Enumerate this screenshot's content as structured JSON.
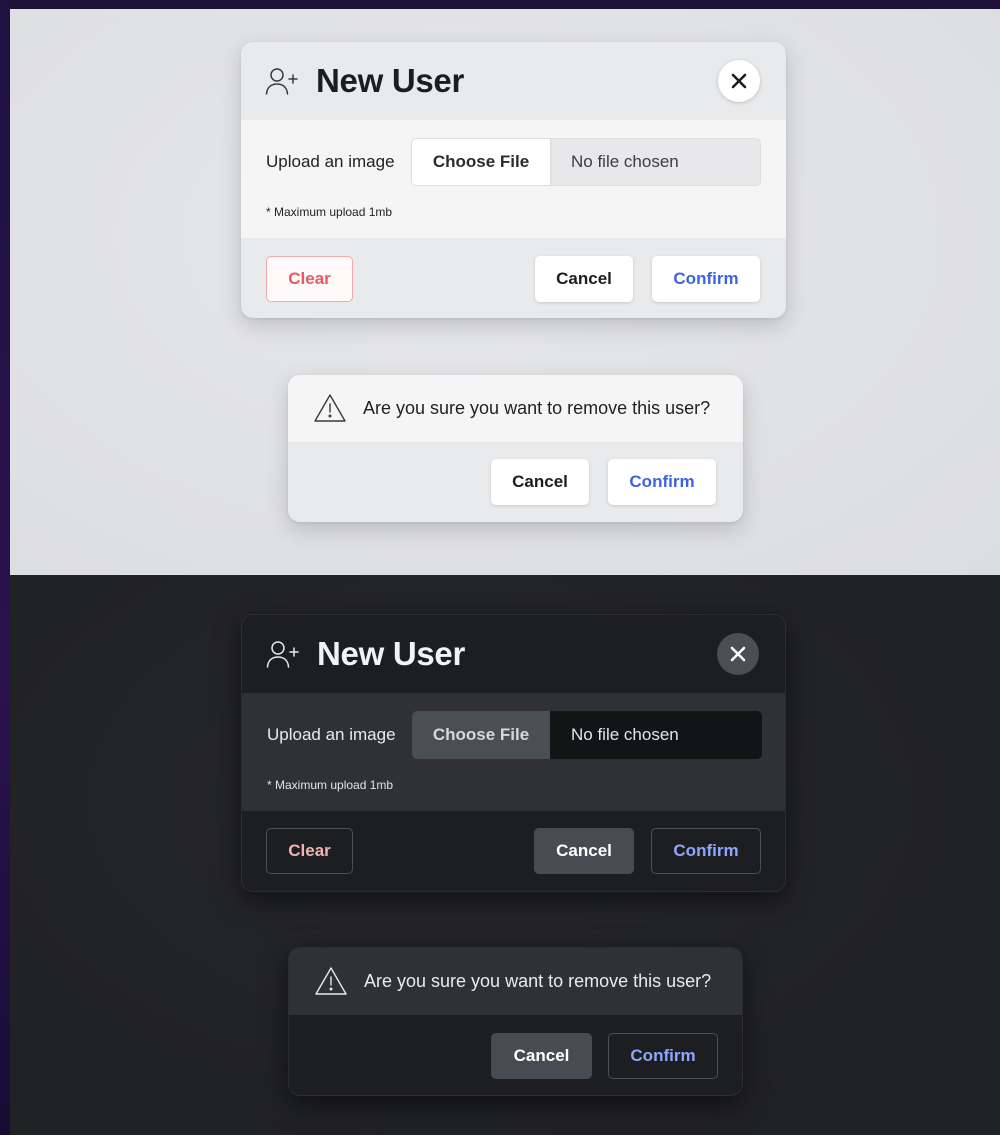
{
  "themes": {
    "light": {
      "new_user_dialog": {
        "title": "New User",
        "upload_label": "Upload an image",
        "choose_file_label": "Choose File",
        "file_status": "No file chosen",
        "max_upload_note": "* Maximum upload 1mb",
        "clear_label": "Clear",
        "cancel_label": "Cancel",
        "confirm_label": "Confirm"
      },
      "confirm_dialog": {
        "message": "Are you sure you want to remove this user?",
        "cancel_label": "Cancel",
        "confirm_label": "Confirm"
      }
    },
    "dark": {
      "new_user_dialog": {
        "title": "New User",
        "upload_label": "Upload an image",
        "choose_file_label": "Choose File",
        "file_status": "No file chosen",
        "max_upload_note": "* Maximum upload 1mb",
        "clear_label": "Clear",
        "cancel_label": "Cancel",
        "confirm_label": "Confirm"
      },
      "confirm_dialog": {
        "message": "Are you sure you want to remove this user?",
        "cancel_label": "Cancel",
        "confirm_label": "Confirm"
      }
    }
  },
  "icons": {
    "title_icon": "user-plus-icon",
    "close_icon": "close-icon",
    "alert_icon": "warning-triangle-icon"
  },
  "colors": {
    "light_confirm": "#3d64df",
    "light_clear": "#e65b64",
    "dark_confirm": "#8fa6ff",
    "dark_clear": "#f3b3b5"
  }
}
